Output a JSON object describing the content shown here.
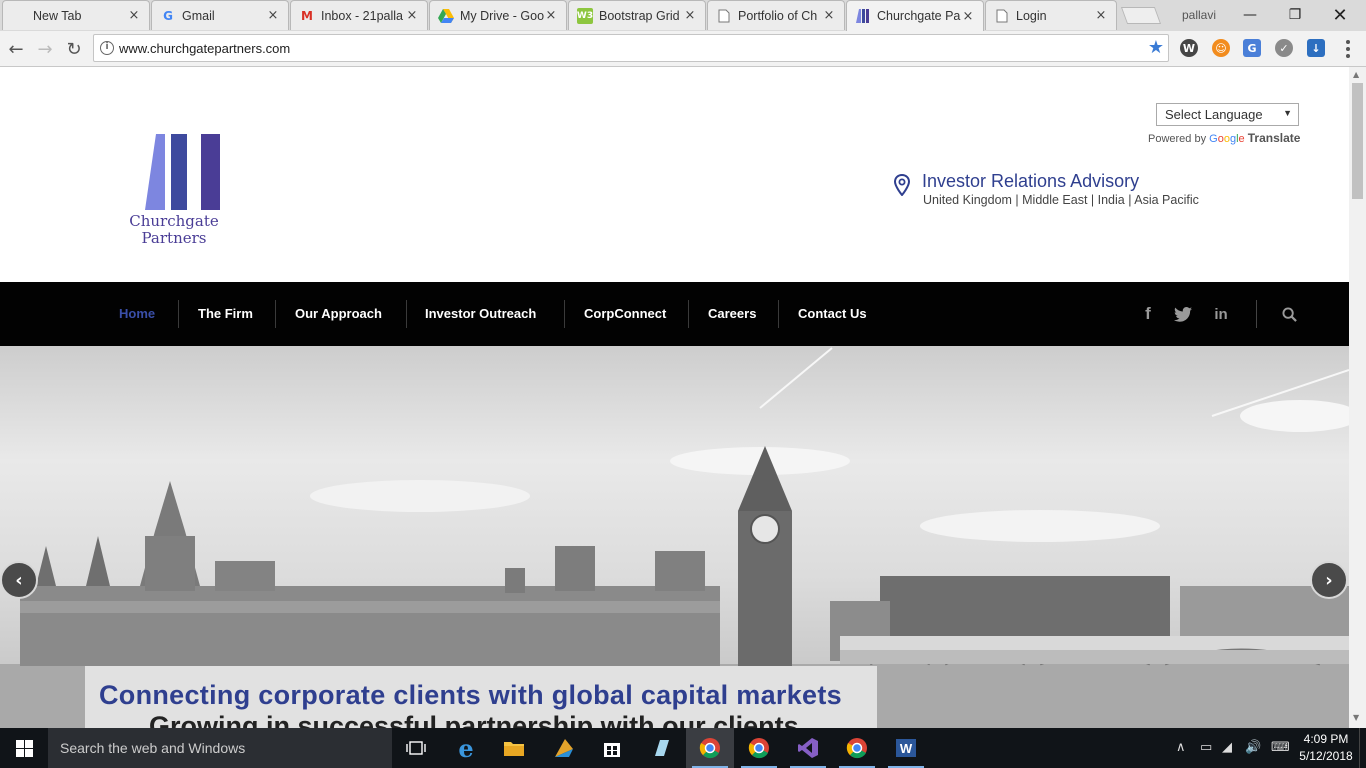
{
  "browser": {
    "tabs": [
      {
        "title": "New Tab",
        "favicon": "blank-page-icon"
      },
      {
        "title": "Gmail",
        "favicon": "google-g-icon"
      },
      {
        "title": "Inbox - 21palla",
        "favicon": "gmail-icon"
      },
      {
        "title": "My Drive - Goo",
        "favicon": "google-drive-icon"
      },
      {
        "title": "Bootstrap Grid",
        "favicon": "bootstrap-icon"
      },
      {
        "title": "Portfolio of Ch",
        "favicon": "page-icon"
      },
      {
        "title": "Churchgate Pa",
        "favicon": "churchgate-icon",
        "active": true
      },
      {
        "title": "Login",
        "favicon": "page-icon"
      }
    ],
    "close_glyph": "×",
    "profile_name": "pallavi",
    "url": "www.churchgatepartners.com"
  },
  "site": {
    "logo_line1": "Churchgate",
    "logo_line2": "Partners",
    "logo_colors": [
      "#7d86e0",
      "#3e4a9e",
      "#4a3d96"
    ],
    "language_select": "Select Language",
    "powered_by": "Powered by",
    "google": [
      "G",
      "o",
      "o",
      "g",
      "l",
      "e"
    ],
    "translate": "Translate",
    "ir_title": "Investor Relations Advisory",
    "ir_regions": "United Kingdom | Middle East | India | Asia Pacific",
    "nav": [
      "Home",
      "The Firm",
      "Our Approach",
      "Investor Outreach",
      "CorpConnect",
      "Careers",
      "Contact Us"
    ],
    "nav_active": "Home",
    "social": {
      "facebook": "f",
      "linkedin": "in"
    },
    "hero_caption_1": "Connecting corporate clients with global capital markets",
    "hero_caption_2": "Growing in successful partnership with our clients",
    "accent_color": "#2f3f8f"
  },
  "taskbar": {
    "search_placeholder": "Search the web and Windows",
    "time": "4:09 PM",
    "date": "5/12/2018"
  }
}
